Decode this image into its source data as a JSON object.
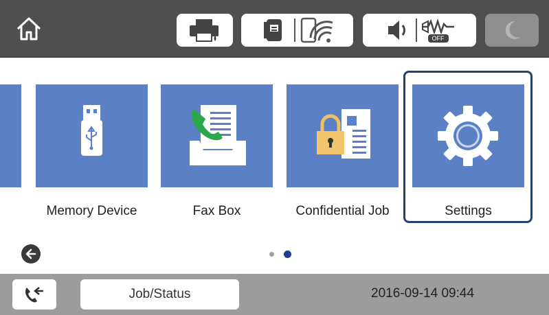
{
  "header": {
    "icons": [
      "home-icon",
      "printer-icon",
      "fax-network-icon",
      "wifi-icon",
      "speaker-icon",
      "quiet-mode-icon",
      "sleep-moon-icon"
    ],
    "quiet_mode_badge": "OFF"
  },
  "tiles": [
    {
      "label": "Memory Device",
      "icon": "usb-icon"
    },
    {
      "label": "Fax Box",
      "icon": "fax-box-icon"
    },
    {
      "label": "Confidential Job",
      "icon": "confidential-job-icon"
    },
    {
      "label": "Settings",
      "icon": "gear-icon",
      "selected": true
    }
  ],
  "pager": {
    "current_page": 2,
    "total_pages": 2
  },
  "footer": {
    "job_status_label": "Job/Status",
    "datetime": "2016-09-14 09:44"
  },
  "colors": {
    "header_bg": "#4f4f4f",
    "tile_bg": "#5b80c5",
    "selection_border": "#27406e",
    "footer_bg": "#9c9c9c",
    "page_dot_active": "#1d3f95",
    "page_dot_inactive": "#a0a0a0"
  }
}
